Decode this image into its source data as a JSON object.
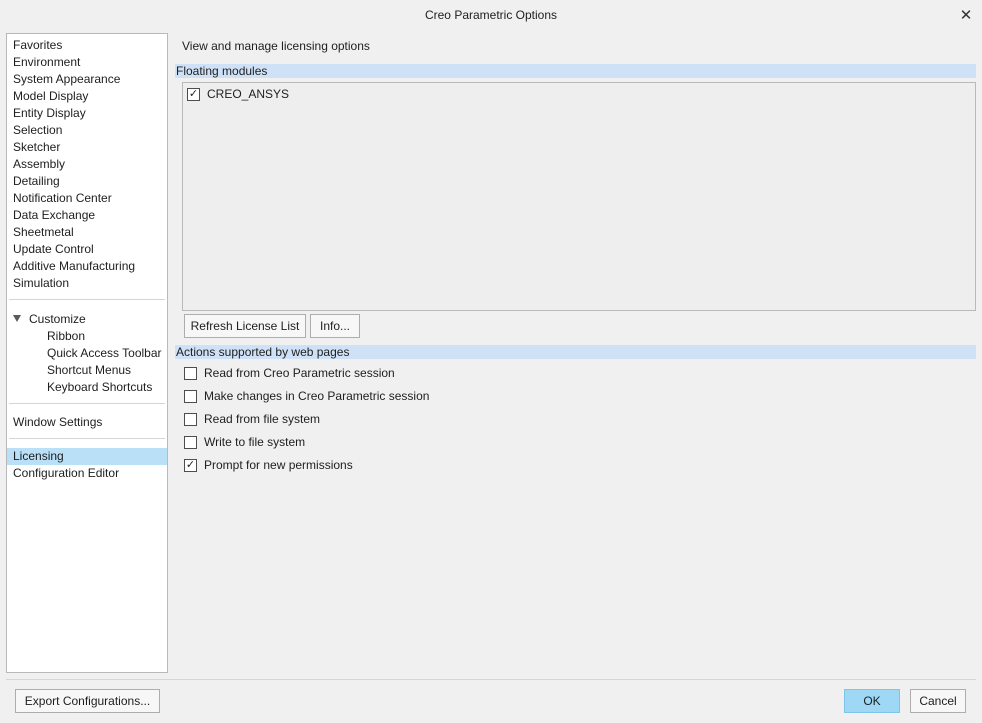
{
  "window": {
    "title": "Creo Parametric Options",
    "close_glyph": "✕"
  },
  "nav": {
    "items": [
      "Favorites",
      "Environment",
      "System Appearance",
      "Model Display",
      "Entity Display",
      "Selection",
      "Sketcher",
      "Assembly",
      "Detailing",
      "Notification Center",
      "Data Exchange",
      "Sheetmetal",
      "Update Control",
      "Additive Manufacturing",
      "Simulation"
    ],
    "customize": {
      "label": "Customize",
      "children": [
        "Ribbon",
        "Quick Access Toolbar",
        "Shortcut Menus",
        "Keyboard Shortcuts"
      ]
    },
    "window_settings": "Window Settings",
    "licensing": "Licensing",
    "configuration_editor": "Configuration Editor",
    "selected": "Licensing"
  },
  "main": {
    "description": "View and manage licensing options",
    "floating_modules": {
      "header": "Floating modules",
      "modules": [
        {
          "name": "CREO_ANSYS",
          "checked": true
        }
      ],
      "refresh_button": "Refresh License List",
      "info_button": "Info..."
    },
    "web_actions": {
      "header": "Actions supported by web pages",
      "options": [
        {
          "label": "Read from Creo Parametric session",
          "checked": false
        },
        {
          "label": "Make changes in Creo Parametric session",
          "checked": false
        },
        {
          "label": "Read from file system",
          "checked": false
        },
        {
          "label": "Write to file system",
          "checked": false
        },
        {
          "label": "Prompt for new permissions",
          "checked": true
        }
      ]
    }
  },
  "footer": {
    "export_button": "Export Configurations...",
    "ok_button": "OK",
    "cancel_button": "Cancel"
  },
  "colors": {
    "selected_item": "#b9e0f7",
    "section_header": "#cfe1f7",
    "primary_button": "#9fd8f5"
  }
}
